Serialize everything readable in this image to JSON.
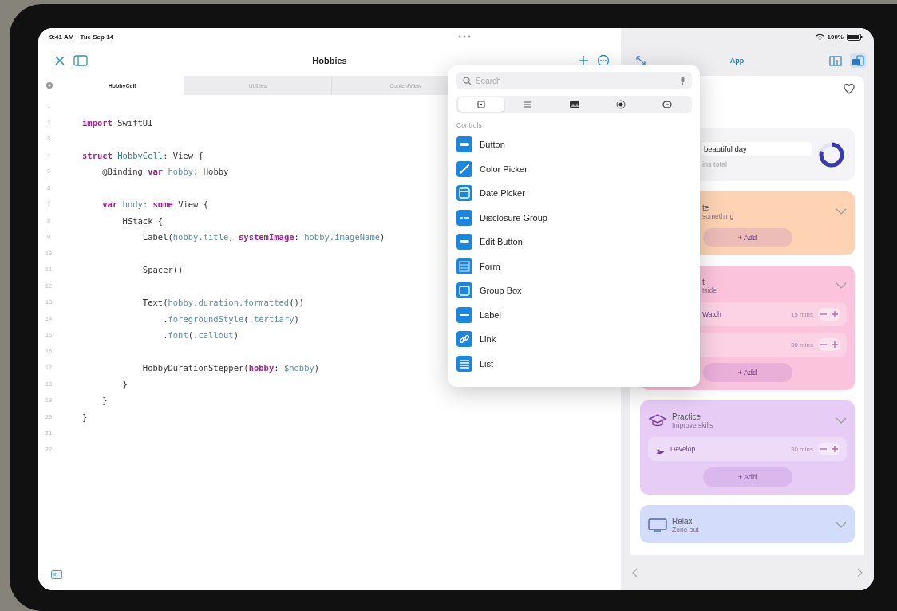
{
  "status_bar": {
    "time": "9:41 AM",
    "date": "Tue Sep 14",
    "battery": "100%"
  },
  "editor": {
    "title": "Hobbies",
    "tabs": [
      {
        "label": "HobbyCell",
        "selected": true
      },
      {
        "label": "Utilities",
        "selected": false
      },
      {
        "label": "ContentView",
        "selected": false
      }
    ],
    "lines": [
      {
        "number": "1"
      },
      {
        "number": "2",
        "tokens": [
          {
            "text": "import",
            "kind": "keyword"
          },
          {
            "text": " SwiftUI",
            "kind": "plain"
          }
        ]
      },
      {
        "number": "3"
      },
      {
        "number": "4",
        "tokens": [
          {
            "text": "struct",
            "kind": "keyword"
          },
          {
            "text": " HobbyCell",
            "kind": "type"
          },
          {
            "text": ": View {",
            "kind": "plain"
          }
        ]
      },
      {
        "number": "5",
        "tokens": [
          {
            "text": "    @Binding ",
            "kind": "plain"
          },
          {
            "text": "var",
            "kind": "keyword"
          },
          {
            "text": " hobby",
            "kind": "property"
          },
          {
            "text": ": Hobby",
            "kind": "plain"
          }
        ]
      },
      {
        "number": "6"
      },
      {
        "number": "7",
        "tokens": [
          {
            "text": "    var",
            "kind": "keyword"
          },
          {
            "text": " body",
            "kind": "property"
          },
          {
            "text": ": ",
            "kind": "plain"
          },
          {
            "text": "some",
            "kind": "keyword"
          },
          {
            "text": " View {",
            "kind": "plain"
          }
        ]
      },
      {
        "number": "8",
        "tokens": [
          {
            "text": "        HStack {",
            "kind": "plain"
          }
        ]
      },
      {
        "number": "9",
        "tokens": [
          {
            "text": "            Label(",
            "kind": "plain"
          },
          {
            "text": "hobby.title",
            "kind": "property"
          },
          {
            "text": ", ",
            "kind": "plain"
          },
          {
            "text": "systemImage",
            "kind": "keyword"
          },
          {
            "text": ": ",
            "kind": "plain"
          },
          {
            "text": "hobby.imageName",
            "kind": "property"
          },
          {
            "text": ")",
            "kind": "plain"
          }
        ]
      },
      {
        "number": "10"
      },
      {
        "number": "11",
        "tokens": [
          {
            "text": "            Spacer()",
            "kind": "plain"
          }
        ]
      },
      {
        "number": "12"
      },
      {
        "number": "13",
        "tokens": [
          {
            "text": "            Text(",
            "kind": "plain"
          },
          {
            "text": "hobby.duration.formatted",
            "kind": "property"
          },
          {
            "text": "())",
            "kind": "plain"
          }
        ]
      },
      {
        "number": "14",
        "tokens": [
          {
            "text": "                .",
            "kind": "plain"
          },
          {
            "text": "foregroundStyle",
            "kind": "property"
          },
          {
            "text": "(.",
            "kind": "plain"
          },
          {
            "text": "tertiary",
            "kind": "property"
          },
          {
            "text": ")",
            "kind": "plain"
          }
        ]
      },
      {
        "number": "15",
        "tokens": [
          {
            "text": "                .",
            "kind": "plain"
          },
          {
            "text": "font",
            "kind": "property"
          },
          {
            "text": "(.",
            "kind": "plain"
          },
          {
            "text": "callout",
            "kind": "property"
          },
          {
            "text": ")",
            "kind": "plain"
          }
        ]
      },
      {
        "number": "16"
      },
      {
        "number": "17",
        "tokens": [
          {
            "text": "            HobbyDurationStepper(",
            "kind": "plain"
          },
          {
            "text": "hobby",
            "kind": "keyword"
          },
          {
            "text": ": ",
            "kind": "plain"
          },
          {
            "text": "$hobby",
            "kind": "property"
          },
          {
            "text": ")",
            "kind": "plain"
          }
        ]
      },
      {
        "number": "18",
        "tokens": [
          {
            "text": "        }",
            "kind": "plain"
          }
        ]
      },
      {
        "number": "19",
        "tokens": [
          {
            "text": "    }",
            "kind": "plain"
          }
        ]
      },
      {
        "number": "20",
        "tokens": [
          {
            "text": "}",
            "kind": "plain"
          }
        ]
      },
      {
        "number": "21"
      },
      {
        "number": "22"
      }
    ]
  },
  "library": {
    "search": {
      "placeholder": "Search"
    },
    "segments": [
      {
        "kind": "controls",
        "selected": true
      },
      {
        "kind": "modifiers",
        "selected": false
      },
      {
        "kind": "image",
        "selected": false
      },
      {
        "kind": "color",
        "selected": false
      },
      {
        "kind": "symbols",
        "selected": false
      }
    ],
    "section": "Controls",
    "items": [
      {
        "label": "Button",
        "kind": "button"
      },
      {
        "label": "Color Picker",
        "kind": "color-picker"
      },
      {
        "label": "Date Picker",
        "kind": "date-picker"
      },
      {
        "label": "Disclosure Group",
        "kind": "disclosure"
      },
      {
        "label": "Edit Button",
        "kind": "edit-button"
      },
      {
        "label": "Form",
        "kind": "form"
      },
      {
        "label": "Group Box",
        "kind": "group-box"
      },
      {
        "label": "Label",
        "kind": "label"
      },
      {
        "label": "Link",
        "kind": "link"
      },
      {
        "label": "List",
        "kind": "list"
      }
    ]
  },
  "preview": {
    "title": "App",
    "modes": [
      {
        "kind": "canvas",
        "selected": false
      },
      {
        "kind": "device",
        "selected": true
      }
    ],
    "summary": {
      "value": "beautiful day",
      "caption": "ins total",
      "level": 0.8
    },
    "categories": [
      {
        "kind": "partial",
        "title": "te",
        "subtitle": "something",
        "color": "#fdd3b4",
        "add": "+ Add"
      },
      {
        "kind": "partial",
        "title": "t",
        "subtitle": "tside",
        "color": "#fbc3dc",
        "rows": [
          {
            "kind": "partial",
            "name": "Watch",
            "duration": "15 mins"
          },
          {
            "kind": "partial",
            "duration": "30 mins"
          }
        ],
        "add": "+ Add"
      },
      {
        "kind": "study",
        "title": "Practice",
        "subtitle": "Improve skills",
        "color": "#e7cdf6",
        "rows": [
          {
            "kind": "coding",
            "name": "Develop",
            "duration": "30 mins"
          }
        ],
        "add": "+ Add"
      },
      {
        "kind": "leisure",
        "title": "Relax",
        "subtitle": "Zone out",
        "color": "#d3dcfb"
      }
    ]
  }
}
